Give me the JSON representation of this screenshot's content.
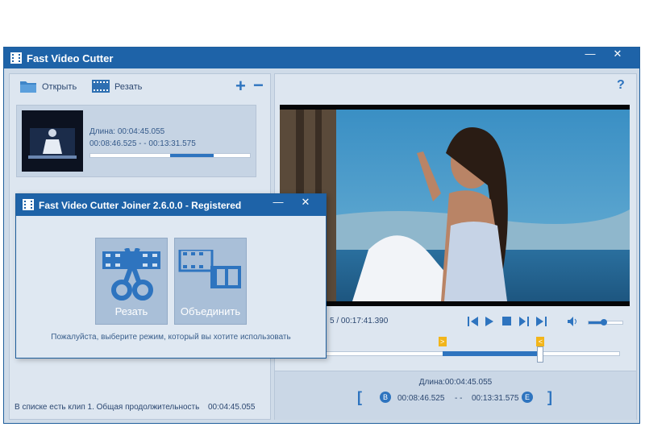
{
  "main_window": {
    "title": "Fast Video Cutter",
    "controls": {
      "minimize": "—",
      "close": "✕"
    }
  },
  "toolbar": {
    "open_label": "Открыть",
    "cut_label": "Резать",
    "add_symbol": "+",
    "remove_symbol": "−",
    "help_symbol": "?"
  },
  "clip": {
    "length_label": "Длина: 00:04:45.055",
    "range": "00:08:46.525  - -  00:13:31.575",
    "progress_fraction": 0.5
  },
  "status_left": {
    "text": "В списке есть клип 1. Общая продолжительность",
    "duration": "00:04:45.055"
  },
  "player": {
    "time_readout": "5 / 00:17:41.390",
    "volume_fraction": 0.45,
    "selection_start_fraction": 0.48,
    "selection_end_fraction": 0.77
  },
  "bottom_info": {
    "length_label": "Длина:00:04:45.055",
    "start": "00:08:46.525",
    "separator": "- -",
    "end": "00:13:31.575",
    "b_marker": "B",
    "e_marker": "E",
    "bracket_open": "[",
    "bracket_close": "]"
  },
  "dialog": {
    "title": "Fast Video Cutter Joiner 2.6.0.0 - Registered",
    "cut_label": "Резать",
    "join_label": "Объединить",
    "hint": "Пожалуйста, выберите режим, который вы хотите использовать",
    "controls": {
      "minimize": "—",
      "close": "✕"
    }
  },
  "colors": {
    "titlebar": "#1e63a8",
    "accent": "#2e74bf",
    "marker": "#f2b51a"
  }
}
